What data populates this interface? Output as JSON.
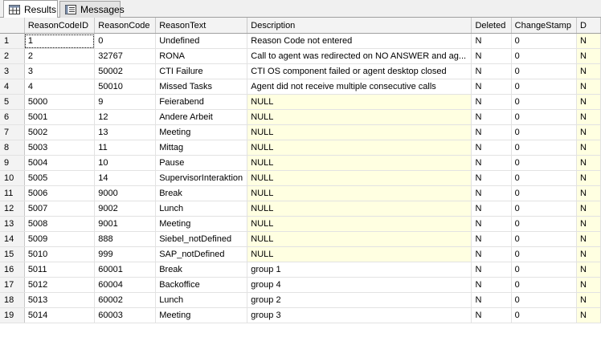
{
  "tabs": [
    {
      "label": "Results",
      "icon": "grid-icon",
      "active": true
    },
    {
      "label": "Messages",
      "icon": "messages-icon",
      "active": false
    }
  ],
  "colors": {
    "null_bg": "#ffffe1",
    "header_bg": "#f3f3f3"
  },
  "grid": {
    "columns": [
      "",
      "ReasonCodeID",
      "ReasonCode",
      "ReasonText",
      "Description",
      "Deleted",
      "ChangeStamp",
      "D"
    ],
    "rows": [
      [
        "1",
        "1",
        "0",
        "Undefined",
        "Reason Code not entered",
        "N",
        "0",
        "N"
      ],
      [
        "2",
        "2",
        "32767",
        "RONA",
        "Call to agent was redirected on NO ANSWER and ag...",
        "N",
        "0",
        "N"
      ],
      [
        "3",
        "3",
        "50002",
        "CTI Failure",
        "CTI OS component failed or agent desktop closed",
        "N",
        "0",
        "N"
      ],
      [
        "4",
        "4",
        "50010",
        "Missed Tasks",
        "Agent did not receive multiple consecutive calls",
        "N",
        "0",
        "N"
      ],
      [
        "5",
        "5000",
        "9",
        "Feierabend",
        "NULL",
        "N",
        "0",
        "N"
      ],
      [
        "6",
        "5001",
        "12",
        "Andere Arbeit",
        "NULL",
        "N",
        "0",
        "N"
      ],
      [
        "7",
        "5002",
        "13",
        "Meeting",
        "NULL",
        "N",
        "0",
        "N"
      ],
      [
        "8",
        "5003",
        "11",
        "Mittag",
        "NULL",
        "N",
        "0",
        "N"
      ],
      [
        "9",
        "5004",
        "10",
        "Pause",
        "NULL",
        "N",
        "0",
        "N"
      ],
      [
        "10",
        "5005",
        "14",
        "SupervisorInteraktion",
        "NULL",
        "N",
        "0",
        "N"
      ],
      [
        "11",
        "5006",
        "9000",
        "Break",
        "NULL",
        "N",
        "0",
        "N"
      ],
      [
        "12",
        "5007",
        "9002",
        "Lunch",
        "NULL",
        "N",
        "0",
        "N"
      ],
      [
        "13",
        "5008",
        "9001",
        "Meeting",
        "NULL",
        "N",
        "0",
        "N"
      ],
      [
        "14",
        "5009",
        "888",
        "Siebel_notDefined",
        "NULL",
        "N",
        "0",
        "N"
      ],
      [
        "15",
        "5010",
        "999",
        "SAP_notDefined",
        "NULL",
        "N",
        "0",
        "N"
      ],
      [
        "16",
        "5011",
        "60001",
        "Break",
        "group 1",
        "N",
        "0",
        "N"
      ],
      [
        "17",
        "5012",
        "60004",
        "Backoffice",
        "group 4",
        "N",
        "0",
        "N"
      ],
      [
        "18",
        "5013",
        "60002",
        "Lunch",
        "group 2",
        "N",
        "0",
        "N"
      ],
      [
        "19",
        "5014",
        "60003",
        "Meeting",
        "group 3",
        "N",
        "0",
        "N"
      ]
    ]
  }
}
